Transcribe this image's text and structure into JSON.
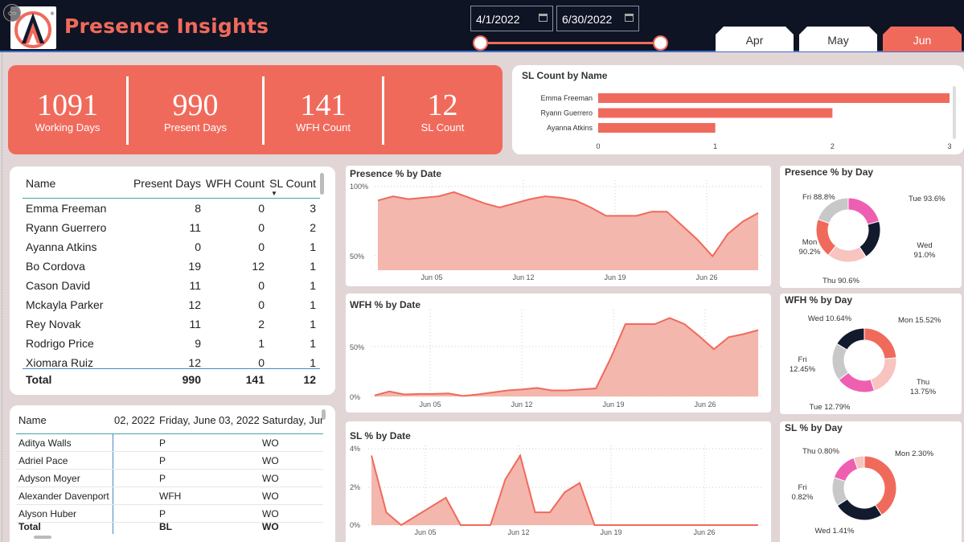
{
  "header": {
    "title": "Presence Insights",
    "start_date": "4/1/2022",
    "end_date": "6/30/2022",
    "months": [
      {
        "label": "Apr",
        "active": false
      },
      {
        "label": "May",
        "active": false
      },
      {
        "label": "Jun",
        "active": true
      }
    ],
    "accent_color": "#f06a5c",
    "bar_color": "#0f1424"
  },
  "kpis": [
    {
      "value": "1091",
      "label": "Working Days"
    },
    {
      "value": "990",
      "label": "Present Days"
    },
    {
      "value": "141",
      "label": "WFH Count"
    },
    {
      "value": "12",
      "label": "SL Count"
    }
  ],
  "summary_table": {
    "headers": [
      "Name",
      "Present Days",
      "WFH Count",
      "SL Count"
    ],
    "rows": [
      [
        "Emma Freeman",
        "8",
        "0",
        "3"
      ],
      [
        "Ryann Guerrero",
        "11",
        "0",
        "2"
      ],
      [
        "Ayanna Atkins",
        "0",
        "0",
        "1"
      ],
      [
        "Bo Cordova",
        "19",
        "12",
        "1"
      ],
      [
        "Cason David",
        "11",
        "0",
        "1"
      ],
      [
        "Mckayla Parker",
        "12",
        "0",
        "1"
      ],
      [
        "Rey Novak",
        "11",
        "2",
        "1"
      ],
      [
        "Rodrigo Price",
        "9",
        "1",
        "1"
      ],
      [
        "Xiomara Ruiz",
        "12",
        "0",
        "1"
      ]
    ],
    "total": [
      "Total",
      "990",
      "141",
      "12"
    ]
  },
  "matrix_table": {
    "headers": [
      "Name",
      "02, 2022",
      "Friday, June 03, 2022",
      "Saturday, Jun"
    ],
    "rows": [
      [
        "Aditya Walls",
        "",
        "P",
        "WO"
      ],
      [
        "Adriel Pace",
        "",
        "P",
        "WO"
      ],
      [
        "Adyson Moyer",
        "",
        "P",
        "WO"
      ],
      [
        "Alexander Davenport",
        "",
        "WFH",
        "WO"
      ],
      [
        "Alyson Huber",
        "",
        "P",
        "WO"
      ]
    ],
    "total": [
      "Total",
      "",
      "BL",
      "WO"
    ]
  },
  "chart_data": [
    {
      "type": "bar",
      "title": "SL Count by Name",
      "categories": [
        "Emma Freeman",
        "Ryann Guerrero",
        "Ayanna Atkins"
      ],
      "values": [
        3,
        2,
        1
      ],
      "xlim": [
        0,
        3
      ],
      "ticks": [
        "0",
        "1",
        "2",
        "3"
      ],
      "orientation": "horizontal"
    },
    {
      "type": "area",
      "title": "Presence % by Date",
      "x": [
        1,
        2,
        3,
        4,
        5,
        6,
        7,
        8,
        9,
        10,
        11,
        12,
        13,
        14,
        15,
        16,
        17,
        18,
        19,
        20,
        21,
        22,
        23,
        24,
        25,
        26,
        27,
        28,
        29,
        30
      ],
      "values": [
        90,
        93,
        91,
        92,
        93,
        96,
        92,
        88,
        85,
        88,
        91,
        93,
        92,
        90,
        85,
        79,
        79,
        79,
        82,
        82,
        72,
        62,
        50,
        66,
        75,
        81
      ],
      "ylim": [
        40,
        100
      ],
      "yticks": [
        "100%",
        "50%"
      ],
      "xticks": [
        "Jun 05",
        "Jun 12",
        "Jun 19",
        "Jun 26"
      ]
    },
    {
      "type": "area",
      "title": "WFH % by Date",
      "values": [
        1,
        5,
        2,
        2.5,
        2.5,
        3,
        0.5,
        2,
        4,
        6,
        7,
        8.5,
        6,
        6,
        7,
        8,
        38,
        72,
        72,
        72,
        78,
        72,
        60,
        47,
        59,
        62,
        66
      ],
      "ylim": [
        0,
        80
      ],
      "yticks": [
        "50%",
        "0%"
      ],
      "xticks": [
        "Jun 05",
        "Jun 12",
        "Jun 19",
        "Jun 26"
      ]
    },
    {
      "type": "area",
      "title": "SL % by Date",
      "values": [
        3.8,
        0.7,
        0,
        0.5,
        1,
        1.5,
        0,
        0,
        0,
        2.5,
        3.8,
        0.7,
        0.7,
        1.8,
        2.3,
        0,
        0,
        0,
        0,
        0,
        0,
        0,
        0,
        0,
        0,
        0,
        0
      ],
      "ylim": [
        0,
        4
      ],
      "yticks": [
        "4%",
        "2%",
        "0%"
      ],
      "xticks": [
        "Jun 05",
        "Jun 12",
        "Jun 19",
        "Jun 26"
      ]
    },
    {
      "type": "pie",
      "title": "Presence % by Day",
      "slices": [
        {
          "label": "Tue 93.6%",
          "value": 93.6,
          "color": "#ee5fb2"
        },
        {
          "label": "Wed 91.0%",
          "value": 91.0,
          "color": "#121a2e"
        },
        {
          "label": "Thu 90.6%",
          "value": 90.6,
          "color": "#f7c4c0"
        },
        {
          "label": "Mon 90.2%",
          "value": 90.2,
          "color": "#f06a5c"
        },
        {
          "label": "Fri 88.8%",
          "value": 88.8,
          "color": "#c8c8c8"
        }
      ]
    },
    {
      "type": "pie",
      "title": "WFH % by Day",
      "slices": [
        {
          "label": "Mon 15.52%",
          "value": 15.52,
          "color": "#f06a5c"
        },
        {
          "label": "Thu 13.75%",
          "value": 13.75,
          "color": "#f7c4c0"
        },
        {
          "label": "Tue 12.79%",
          "value": 12.79,
          "color": "#ee5fb2"
        },
        {
          "label": "Fri 12.45%",
          "value": 12.45,
          "color": "#c8c8c8"
        },
        {
          "label": "Wed 10.64%",
          "value": 10.64,
          "color": "#121a2e"
        }
      ]
    },
    {
      "type": "pie",
      "title": "SL % by Day",
      "slices": [
        {
          "label": "Mon 2.30%",
          "value": 2.3,
          "color": "#f06a5c"
        },
        {
          "label": "Wed 1.41%",
          "value": 1.41,
          "color": "#121a2e"
        },
        {
          "label": "Fri 0.82%",
          "value": 0.82,
          "color": "#c8c8c8"
        },
        {
          "label": "Thu 0.80%",
          "value": 0.8,
          "color": "#ee5fb2"
        },
        {
          "label": "",
          "value": 0.3,
          "color": "#f7c4c0"
        }
      ]
    }
  ]
}
